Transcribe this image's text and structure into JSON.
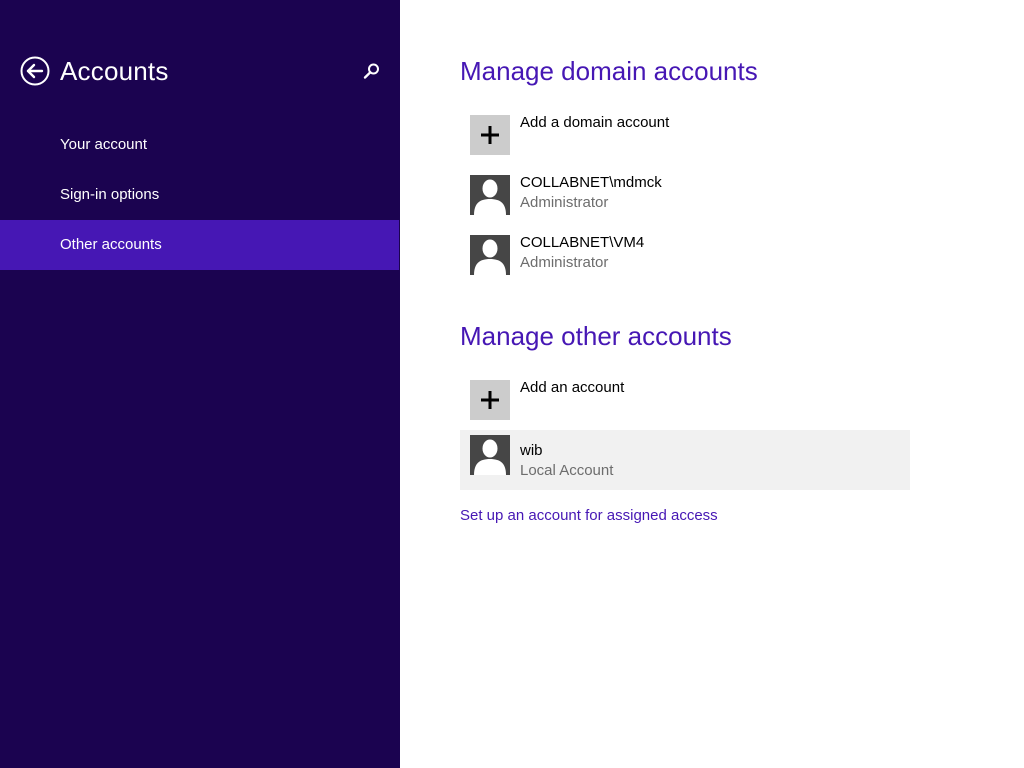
{
  "sidebar": {
    "title": "Accounts",
    "back_icon": "back-arrow-icon",
    "search_icon": "search-icon",
    "items": [
      {
        "label": "Your account",
        "selected": false
      },
      {
        "label": "Sign-in options",
        "selected": false
      },
      {
        "label": "Other accounts",
        "selected": true
      }
    ]
  },
  "main": {
    "domain_section": {
      "title": "Manage domain accounts",
      "add_label": "Add a domain account",
      "accounts": [
        {
          "name": "COLLABNET\\mdmck",
          "role": "Administrator"
        },
        {
          "name": "COLLABNET\\VM4",
          "role": "Administrator"
        }
      ]
    },
    "other_section": {
      "title": "Manage other accounts",
      "add_label": "Add an account",
      "accounts": [
        {
          "name": "wib",
          "role": "Local Account"
        }
      ]
    },
    "assigned_access_link": "Set up an account for assigned access"
  },
  "colors": {
    "sidebar_bg": "#1b0350",
    "selected_bg": "#4617b4",
    "accent": "#4617b4",
    "tile_plus_bg": "#cccccc",
    "tile_user_bg": "#464646",
    "highlight_bg": "#f1f1f1"
  }
}
